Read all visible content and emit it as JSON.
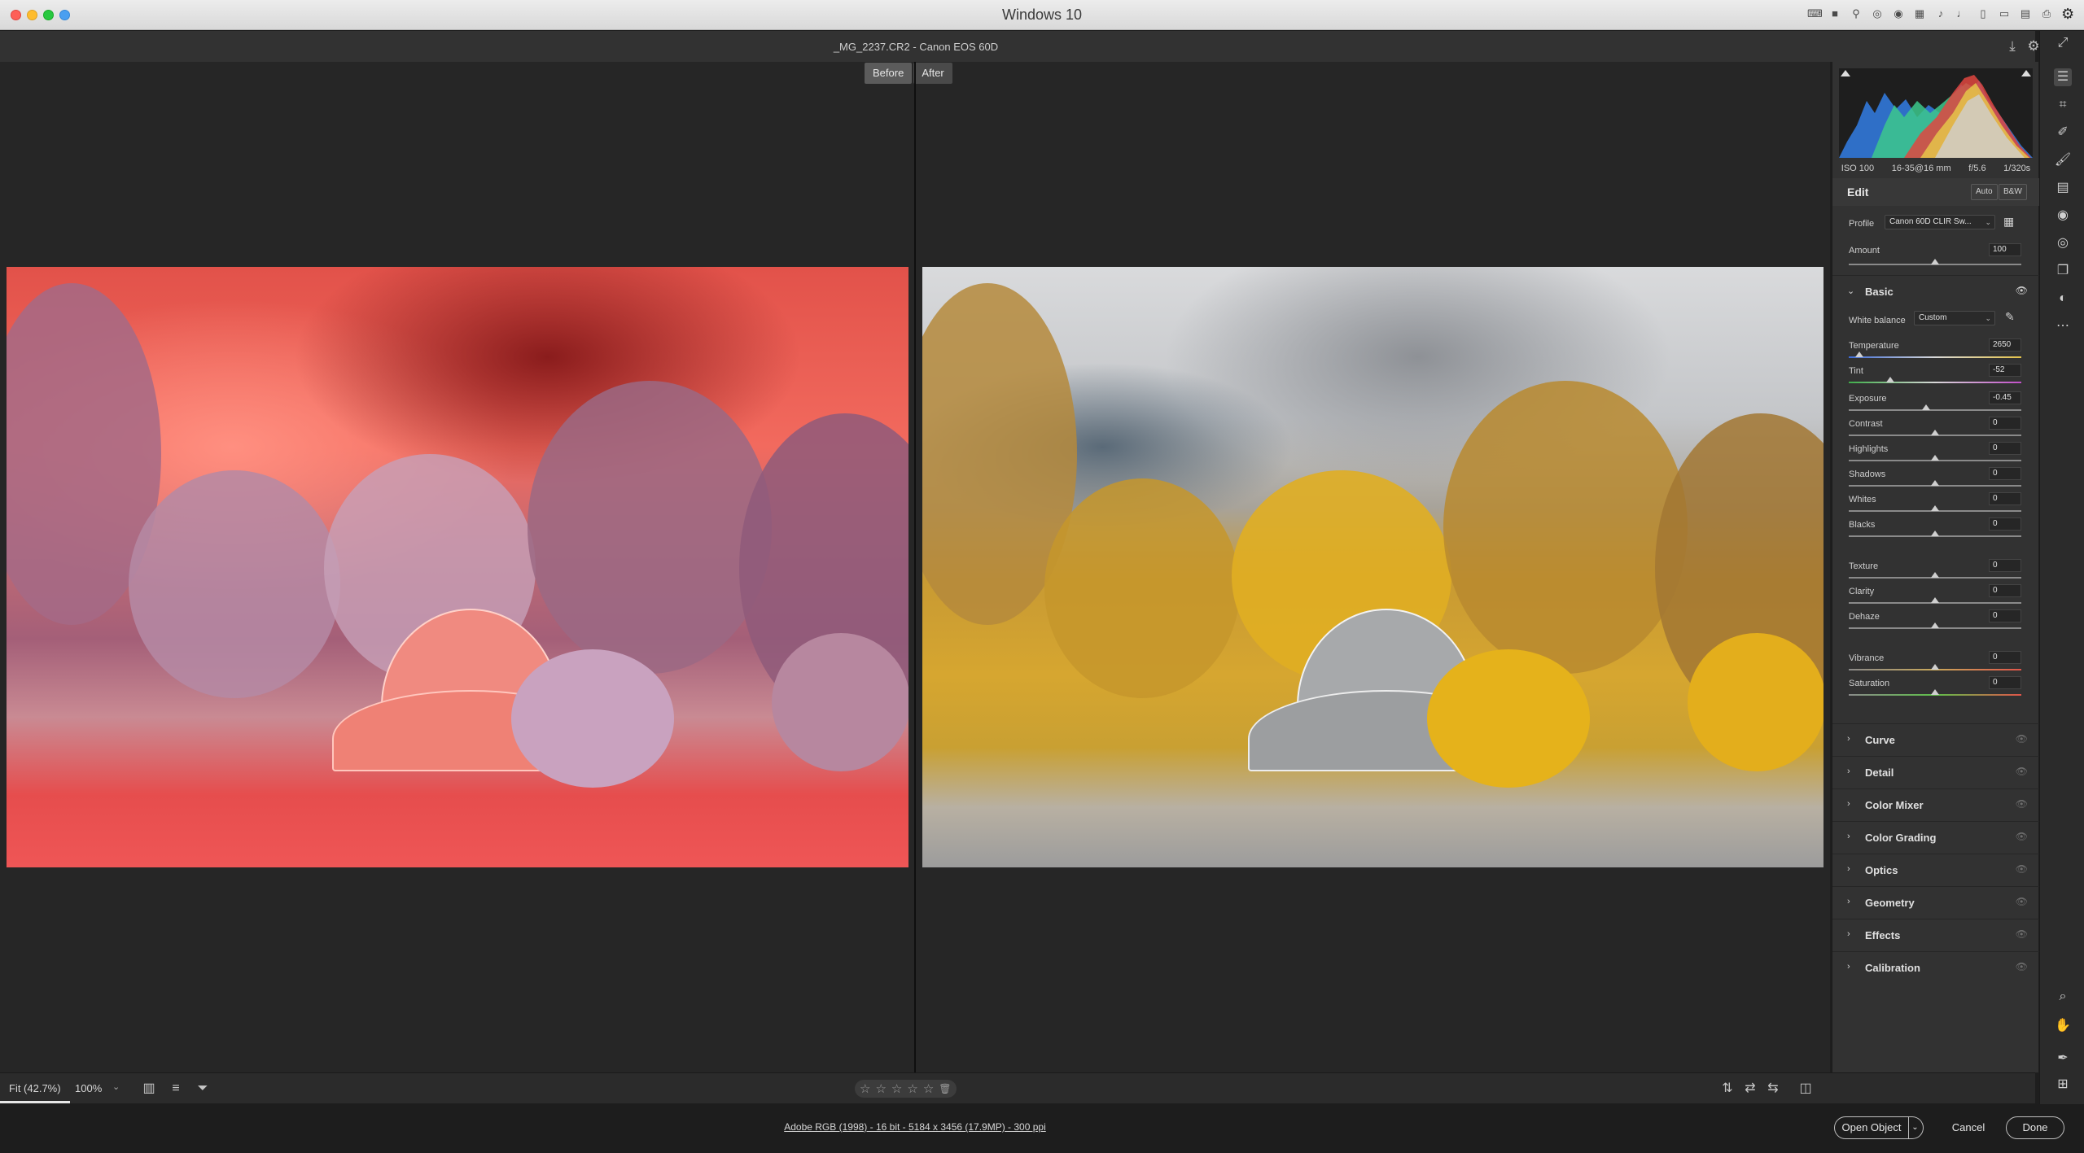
{
  "window": {
    "title": "Windows 10"
  },
  "header": {
    "file_title": "_MG_2237.CR2  -  Canon EOS 60D"
  },
  "compare": {
    "before_label": "Before",
    "after_label": "After"
  },
  "histogram": {
    "exif": {
      "iso": "ISO 100",
      "lens": "16-35@16 mm",
      "aperture": "f/5.6",
      "shutter": "1/320s"
    }
  },
  "edit": {
    "title": "Edit",
    "auto_label": "Auto",
    "bw_label": "B&W",
    "profile_label": "Profile",
    "profile_value": "Canon 60D CLIR Sw...",
    "amount_label": "Amount",
    "amount_value": "100",
    "amount_level": 0.5
  },
  "basic": {
    "title": "Basic",
    "white_balance_label": "White balance",
    "white_balance_value": "Custom",
    "temperature": {
      "label": "Temperature",
      "value": "2650",
      "level": 0.06
    },
    "tint": {
      "label": "Tint",
      "value": "-52",
      "level": 0.24
    },
    "sliders": [
      {
        "label": "Exposure",
        "value": "-0.45",
        "level": 0.45
      },
      {
        "label": "Contrast",
        "value": "0",
        "level": 0.5
      },
      {
        "label": "Highlights",
        "value": "0",
        "level": 0.5
      },
      {
        "label": "Shadows",
        "value": "0",
        "level": 0.5
      },
      {
        "label": "Whites",
        "value": "0",
        "level": 0.5
      },
      {
        "label": "Blacks",
        "value": "0",
        "level": 0.5
      },
      {
        "label": "Texture",
        "value": "0",
        "level": 0.5
      },
      {
        "label": "Clarity",
        "value": "0",
        "level": 0.5
      },
      {
        "label": "Dehaze",
        "value": "0",
        "level": 0.5
      },
      {
        "label": "Vibrance",
        "value": "0",
        "level": 0.5
      },
      {
        "label": "Saturation",
        "value": "0",
        "level": 0.5
      }
    ]
  },
  "sections": [
    "Curve",
    "Detail",
    "Color Mixer",
    "Color Grading",
    "Optics",
    "Geometry",
    "Effects",
    "Calibration"
  ],
  "bottom_bar": {
    "zoom_fit": "Fit (42.7%)",
    "zoom_percent": "100%",
    "stars": [
      "☆",
      "☆",
      "☆",
      "☆",
      "☆"
    ]
  },
  "status": {
    "workflow_options": "Adobe RGB (1998) - 16 bit - 5184 x 3456 (17.9MP) - 300 ppi",
    "open_object": "Open Object",
    "cancel": "Cancel",
    "done": "Done"
  },
  "colors": {
    "panel_bg": "#323232",
    "workspace_bg": "#262626",
    "before_tint": "#e8524c",
    "after_tint": "#d6a630"
  }
}
